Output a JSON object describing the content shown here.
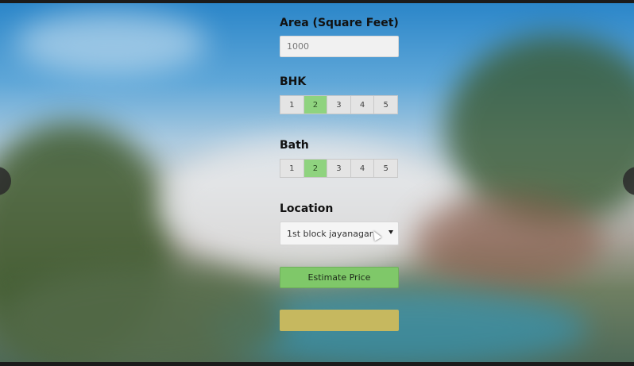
{
  "form": {
    "area": {
      "label": "Area (Square Feet)",
      "value": "1000"
    },
    "bhk": {
      "label": "BHK",
      "options": [
        "1",
        "2",
        "3",
        "4",
        "5"
      ],
      "selected": "2"
    },
    "bath": {
      "label": "Bath",
      "options": [
        "1",
        "2",
        "3",
        "4",
        "5"
      ],
      "selected": "2"
    },
    "location": {
      "label": "Location",
      "selected": "1st block jayanagar"
    },
    "estimate_button": "Estimate Price",
    "result": ""
  },
  "colors": {
    "selected_option": "#8fd37f",
    "estimate_button": "#7fc869",
    "result_box": "#c6b85f"
  }
}
